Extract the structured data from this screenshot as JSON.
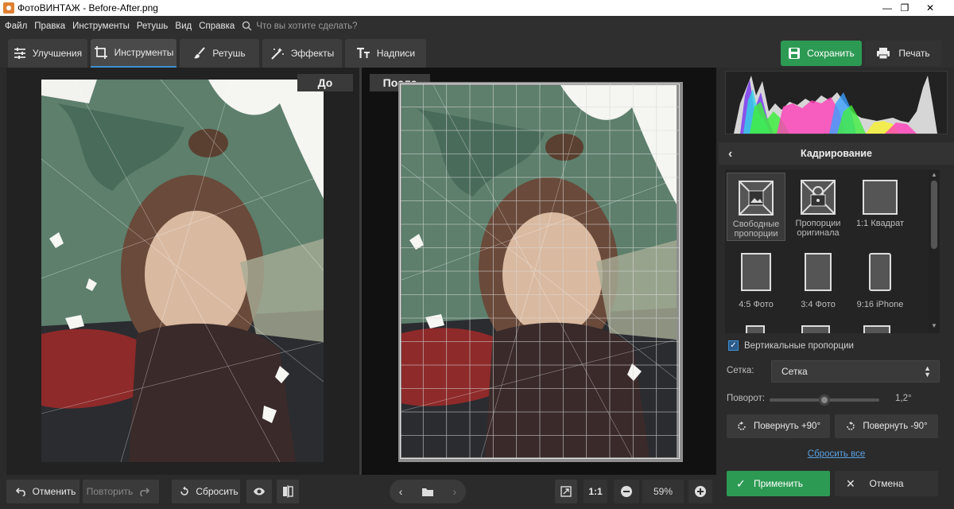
{
  "window": {
    "title": "ФотоВИНТАЖ - Before-After.png",
    "minimize": "—",
    "restore": "❐",
    "close": "✕"
  },
  "menu": {
    "items": [
      "Файл",
      "Правка",
      "Инструменты",
      "Ретушь",
      "Вид",
      "Справка"
    ],
    "search_placeholder": "Что вы хотите сделать?"
  },
  "tabs": [
    {
      "label": "Улучшения",
      "icon": "sliders-icon"
    },
    {
      "label": "Инструменты",
      "icon": "crop-icon",
      "active": true
    },
    {
      "label": "Ретушь",
      "icon": "brush-icon"
    },
    {
      "label": "Эффекты",
      "icon": "magic-wand-icon"
    },
    {
      "label": "Надписи",
      "icon": "text-icon"
    }
  ],
  "toolbar": {
    "save_label": "Сохранить",
    "print_label": "Печать"
  },
  "compare": {
    "before_label": "До",
    "after_label": "После"
  },
  "crop_panel": {
    "title": "Кадрирование",
    "presets": [
      {
        "label_line1": "Свободные",
        "label_line2": "пропорции",
        "icon": "free-crop-icon",
        "selected": true
      },
      {
        "label_line1": "Пропорции",
        "label_line2": "оригинала",
        "icon": "locked-crop-icon"
      },
      {
        "label_line1": "1:1 Квадрат",
        "label_line2": "",
        "icon": "square-icon"
      },
      {
        "label_line1": "4:5 Фото",
        "label_line2": "",
        "icon": "portrait-45-icon"
      },
      {
        "label_line1": "3:4 Фото",
        "label_line2": "",
        "icon": "portrait-34-icon"
      },
      {
        "label_line1": "9:16 iPhone",
        "label_line2": "",
        "icon": "portrait-916-icon"
      }
    ],
    "vertical_label": "Вертикальные пропорции",
    "vertical_checked": true,
    "grid_label": "Сетка:",
    "grid_value": "Сетка",
    "rotation_label": "Поворот:",
    "rotation_value": "1,2°",
    "rotation_fraction": 0.5,
    "rotate_plus": "Повернуть +90°",
    "rotate_minus": "Повернуть -90°",
    "reset_all": "Сбросить все",
    "apply": "Применить",
    "cancel": "Отмена"
  },
  "bottom": {
    "undo": "Отменить",
    "redo": "Повторить",
    "reset": "Сбросить",
    "ratio": "1:1",
    "zoom": "59%"
  },
  "colors": {
    "accent_green": "#2d9a54",
    "accent_blue": "#3d8fd4",
    "link": "#5aa0e0"
  }
}
